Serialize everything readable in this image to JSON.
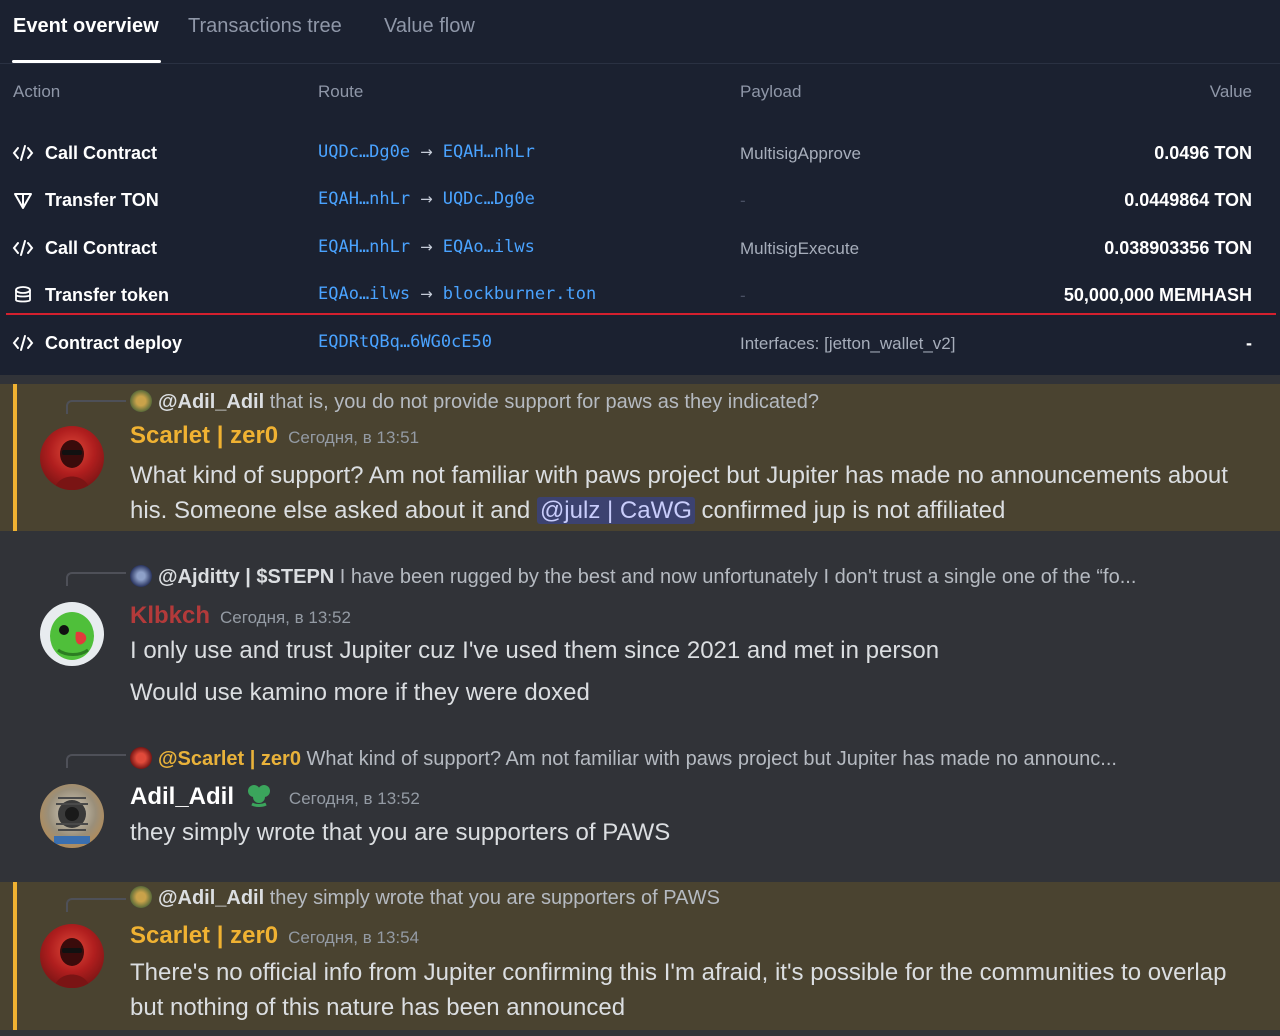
{
  "tabs": [
    {
      "label": "Event overview"
    },
    {
      "label": "Transactions tree"
    },
    {
      "label": "Value flow"
    }
  ],
  "columns": {
    "action": "Action",
    "route": "Route",
    "payload": "Payload",
    "value": "Value"
  },
  "rows": [
    {
      "icon": "code-icon",
      "action": "Call Contract",
      "from": "UQDc…Dg0e",
      "to": "EQAH…nhLr",
      "payload": "MultisigApprove",
      "value": "0.0496 TON"
    },
    {
      "icon": "ton-icon",
      "action": "Transfer TON",
      "from": "EQAH…nhLr",
      "to": "UQDc…Dg0e",
      "payload": "-",
      "value": "0.0449864 TON"
    },
    {
      "icon": "code-icon",
      "action": "Call Contract",
      "from": "EQAH…nhLr",
      "to": "EQAo…ilws",
      "payload": "MultisigExecute",
      "value": "0.038903356 TON"
    },
    {
      "icon": "coins-icon",
      "action": "Transfer token",
      "from": "EQAo…ilws",
      "to": "blockburner.ton",
      "payload": "-",
      "value": "50,000,000 MEMHASH"
    },
    {
      "icon": "code-icon",
      "action": "Contract deploy",
      "from": "EQDRtQBq…6WG0cE50",
      "to": "",
      "payload": "Interfaces: [jetton_wallet_v2]",
      "value": "-"
    }
  ],
  "messages": [
    {
      "reply_mention": "@Adil_Adil",
      "reply_text": "that is, you do not provide support for paws as they indicated?",
      "author": "Scarlet | zer0",
      "author_color": "#f0b232",
      "time": "Сегодня, в 13:51",
      "text_before": "What kind of support? Am not familiar with paws project but Jupiter has made no announcements about his. Someone else asked about it and ",
      "text_mention": "@julz | CaWG",
      "text_after": " confirmed jup is not affiliated"
    },
    {
      "reply_mention": "@Ajditty | $STEPN",
      "reply_text": "I have been rugged by the best and now unfortunately I don't trust a single one of the “fo...",
      "author": "Klbkch",
      "author_color": "#b33a3a",
      "time": "Сегодня, в 13:52",
      "line1": "I only use and trust Jupiter cuz I've used them since 2021 and met in person",
      "line2": "Would use kamino more if they were doxed"
    },
    {
      "reply_mention": "@Scarlet | zer0",
      "reply_text": "What kind of support? Am not familiar with paws project but Jupiter has made no announc...",
      "author": "Adil_Adil",
      "author_color": "#ffffff",
      "time": "Сегодня, в 13:52",
      "line1": "they simply wrote that you are supporters of PAWS"
    },
    {
      "reply_mention": "@Adil_Adil",
      "reply_text": "they simply wrote that you are supporters of PAWS",
      "author": "Scarlet | zer0",
      "author_color": "#f0b232",
      "time": "Сегодня, в 13:54",
      "line1": "There's no official info from Jupiter confirming this I'm afraid, it's possible for the communities to overlap but nothing of this nature has been announced"
    }
  ]
}
